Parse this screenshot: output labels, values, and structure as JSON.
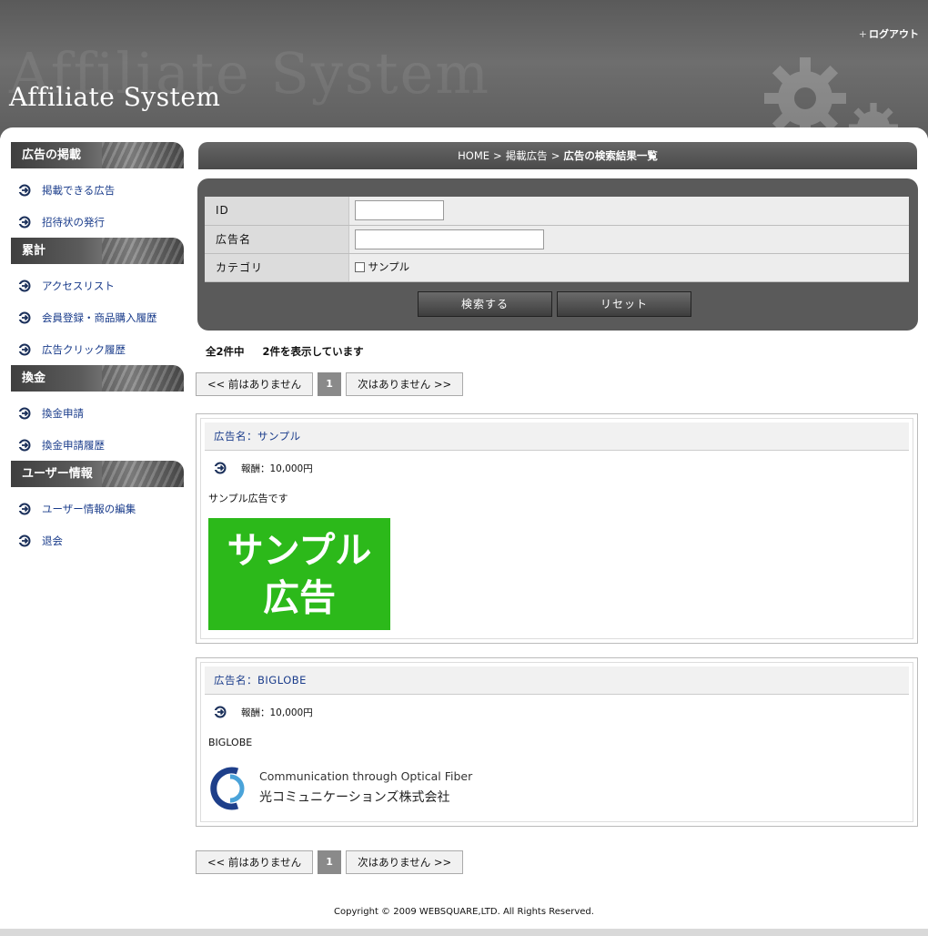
{
  "header": {
    "logo": "Affiliate System",
    "logout_label": "ログアウト"
  },
  "sidebar": {
    "sections": [
      {
        "title": "広告の掲載",
        "items": [
          "掲載できる広告",
          "招待状の発行"
        ]
      },
      {
        "title": "累計",
        "items": [
          "アクセスリスト",
          "会員登録・商品購入履歴",
          "広告クリック履歴"
        ]
      },
      {
        "title": "換金",
        "items": [
          "換金申請",
          "換金申請履歴"
        ]
      },
      {
        "title": "ユーザー情報",
        "items": [
          "ユーザー情報の編集",
          "退会"
        ]
      }
    ]
  },
  "breadcrumb": {
    "home": "HOME",
    "parent": "掲載広告",
    "current": "広告の検索結果一覧"
  },
  "search": {
    "fields": [
      {
        "label": "ID",
        "value": ""
      },
      {
        "label": "広告名",
        "value": ""
      },
      {
        "label": "カテゴリ",
        "option": "サンプル",
        "checked": false
      }
    ],
    "submit_label": "検索する",
    "reset_label": "リセット"
  },
  "results": {
    "total": "全2件中",
    "showing": "2件を表示しています"
  },
  "pager": {
    "prev_label": "<< 前はありません",
    "page": "1",
    "next_label": "次はありません >>"
  },
  "ads": [
    {
      "title": "広告名：サンプル",
      "reward": "報酬：10,000円",
      "description": "サンプル広告です",
      "banner_lines": [
        "サンプル",
        "広告"
      ],
      "banner_color": "#2cb91a"
    },
    {
      "title": "広告名：BIGLOBE",
      "reward": "報酬：10,000円",
      "description": "BIGLOBE",
      "banner_lines": [
        "Communication through Optical Fiber",
        "光コミュニケーションズ株式会社"
      ],
      "banner_color": "#ffffff"
    }
  ],
  "footer": {
    "copyright": "Copyright © 2009 WEBSQUARE,LTD. All Rights Reserved."
  },
  "colors": {
    "link": "#1a3c8b",
    "header_bg": "#5a5a5a",
    "banner_green": "#2cb91a"
  }
}
